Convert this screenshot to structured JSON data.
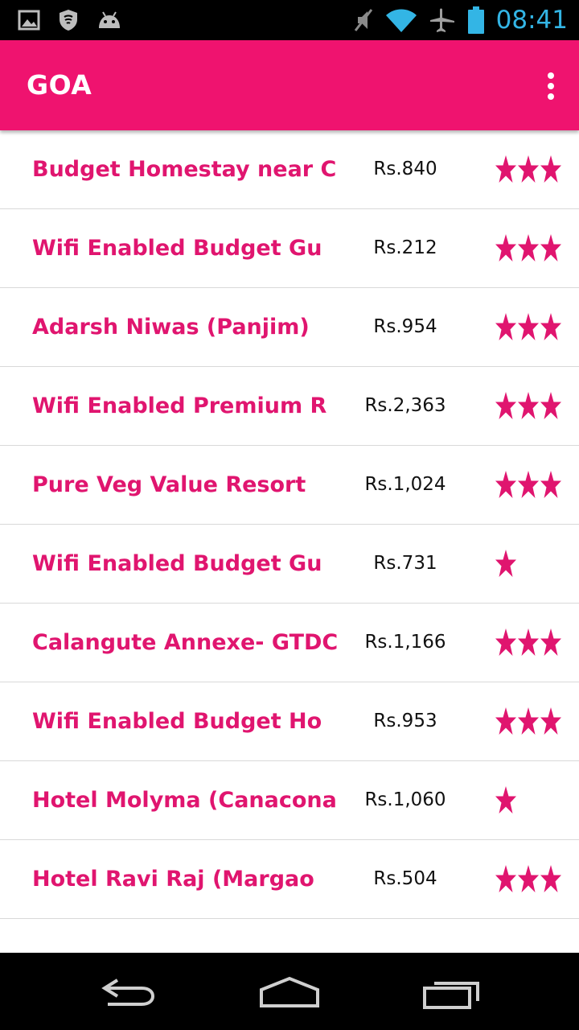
{
  "status_bar": {
    "time": "08:41",
    "left_icons": [
      "image-notification-icon",
      "shield-notification-icon",
      "android-notification-icon"
    ],
    "right_icons": [
      "muted-icon",
      "wifi-icon",
      "airplane-icon",
      "battery-icon"
    ]
  },
  "app_bar": {
    "title": "GOA",
    "overflow_icon": "overflow-menu-icon"
  },
  "colors": {
    "accent": "#ef136f",
    "name_text": "#e0156f",
    "star": "#e0156f",
    "clock": "#33b5e5"
  },
  "listings": [
    {
      "name": "Budget Homestay near C",
      "price": "Rs.840",
      "stars": 3
    },
    {
      "name": "Wifi Enabled Budget Gu",
      "price": "Rs.212",
      "stars": 3
    },
    {
      "name": "Adarsh Niwas (Panjim)",
      "price": "Rs.954",
      "stars": 3
    },
    {
      "name": "Wifi Enabled Premium R",
      "price": "Rs.2,363",
      "stars": 3
    },
    {
      "name": "Pure Veg Value Resort",
      "price": "Rs.1,024",
      "stars": 3
    },
    {
      "name": "Wifi Enabled Budget Gu",
      "price": "Rs.731",
      "stars": 1
    },
    {
      "name": "Calangute Annexe- GTDC",
      "price": "Rs.1,166",
      "stars": 3
    },
    {
      "name": "Wifi Enabled Budget Ho",
      "price": "Rs.953",
      "stars": 3
    },
    {
      "name": "Hotel Molyma (Canacona",
      "price": "Rs.1,060",
      "stars": 1
    },
    {
      "name": "Hotel Ravi Raj (Margao",
      "price": "Rs.504",
      "stars": 3
    }
  ],
  "nav_bar": {
    "buttons": [
      "back-icon",
      "home-icon",
      "recent-apps-icon"
    ]
  }
}
